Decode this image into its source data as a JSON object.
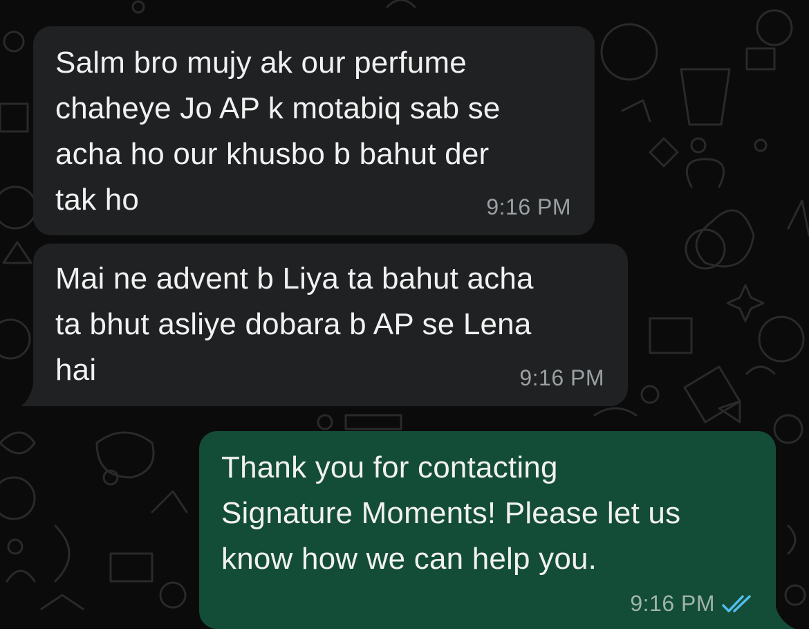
{
  "conversation": {
    "messages": [
      {
        "direction": "incoming",
        "text": "Salm bro mujy ak our perfume\nchaheye Jo AP k motabiq sab se\nacha ho our khusbo b bahut der\ntak ho",
        "time": "9:16 PM"
      },
      {
        "direction": "incoming",
        "text": "Mai ne advent b Liya ta bahut acha\nta bhut asliye dobara b AP se Lena\nhai",
        "time": "9:16 PM"
      },
      {
        "direction": "outgoing",
        "text": "Thank you for contacting\nSignature Moments! Please let us\nknow how we can help you.",
        "time": "9:16 PM",
        "status": "read"
      }
    ]
  },
  "icons": {
    "read_receipt": "double-check-icon"
  },
  "colors": {
    "background": "#0b0b0b",
    "incoming_bubble": "#1f2122",
    "outgoing_bubble": "#144d37",
    "read_tick": "#53bdeb"
  }
}
